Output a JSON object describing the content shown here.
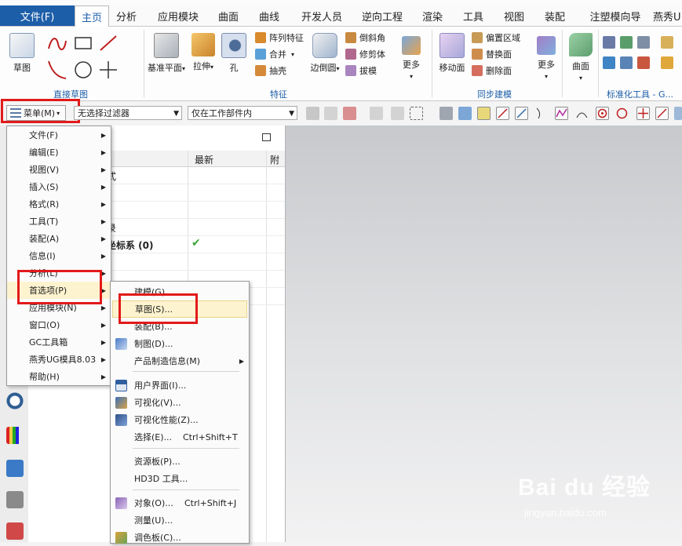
{
  "ribbon_tabs": {
    "file": "文件(F)",
    "items": [
      "主页",
      "分析",
      "应用模块",
      "曲面",
      "曲线",
      "开发人员",
      "逆向工程",
      "渲染",
      "工具",
      "视图",
      "装配",
      "注塑模向导",
      "燕秀U"
    ]
  },
  "ribbon": {
    "sketch_label": "草图",
    "direct_sketch_group": "直接草图",
    "datum_plane": "基准平面",
    "extrude": "拉伸",
    "hole": "孔",
    "pattern_feature": "阵列特征",
    "unite": "合并",
    "shell": "抽壳",
    "edge_blend": "边倒圆",
    "chamfer": "倒斜角",
    "trim_body": "修剪体",
    "draft": "拔模",
    "more": "更多",
    "feature_group": "特征",
    "move_face": "移动面",
    "offset_region": "偏置区域",
    "replace_face": "替换面",
    "delete_face": "删除面",
    "more2": "更多",
    "sync_group": "同步建模",
    "surface": "曲面",
    "more3": "更多",
    "std_tools_group": "标准化工具 - G..."
  },
  "toolbar": {
    "menu_button": "菜单(M)",
    "filter_combo": "无选择过滤器",
    "scope_combo": "仅在工作部件内"
  },
  "navigator": {
    "col_latest": "最新",
    "col_extra": "附",
    "rows": [
      {
        "name": "式",
        "latest": ""
      },
      {
        "name": "",
        "latest": ""
      },
      {
        "name": "",
        "latest": ""
      },
      {
        "name": "录",
        "latest": ""
      },
      {
        "name": "坐标系 (0)",
        "latest": "✔"
      }
    ]
  },
  "main_menu": {
    "items": [
      {
        "label": "文件(F)",
        "sub": true
      },
      {
        "label": "编辑(E)",
        "sub": true
      },
      {
        "label": "视图(V)",
        "sub": true
      },
      {
        "label": "插入(S)",
        "sub": true
      },
      {
        "label": "格式(R)",
        "sub": true
      },
      {
        "label": "工具(T)",
        "sub": true
      },
      {
        "label": "装配(A)",
        "sub": true
      },
      {
        "label": "信息(I)",
        "sub": true
      },
      {
        "label": "分析(L)",
        "sub": true
      },
      {
        "label": "首选项(P)",
        "sub": true
      },
      {
        "label": "应用模块(N)",
        "sub": true
      },
      {
        "label": "窗口(O)",
        "sub": true
      },
      {
        "label": "GC工具箱",
        "sub": true
      },
      {
        "label": "燕秀UG模具8.03",
        "sub": true
      },
      {
        "label": "帮助(H)",
        "sub": true
      }
    ]
  },
  "pref_menu": {
    "items": [
      {
        "label": "建模(G)...",
        "shortcut": ""
      },
      {
        "label": "草图(S)...",
        "shortcut": ""
      },
      {
        "label": "装配(B)...",
        "shortcut": ""
      },
      {
        "label": "制图(D)...",
        "shortcut": ""
      },
      {
        "label": "产品制造信息(M)",
        "shortcut": ""
      },
      {
        "label": "用户界面(I)...",
        "shortcut": ""
      },
      {
        "label": "可视化(V)...",
        "shortcut": ""
      },
      {
        "label": "可视化性能(Z)...",
        "shortcut": ""
      },
      {
        "label": "选择(E)...",
        "shortcut": "Ctrl+Shift+T"
      },
      {
        "label": "资源板(P)...",
        "shortcut": ""
      },
      {
        "label": "HD3D 工具...",
        "shortcut": ""
      },
      {
        "label": "对象(O)...",
        "shortcut": "Ctrl+Shift+J"
      },
      {
        "label": "测量(U)...",
        "shortcut": ""
      },
      {
        "label": "调色板(C)...",
        "shortcut": ""
      }
    ]
  },
  "watermark": {
    "brand": "Bai du 经验",
    "url": "jingyan.baidu.com"
  },
  "colors": {
    "accent": "#1d5ea8",
    "highlight_box": "#e21a1a",
    "hover": "#fdf3cf"
  }
}
